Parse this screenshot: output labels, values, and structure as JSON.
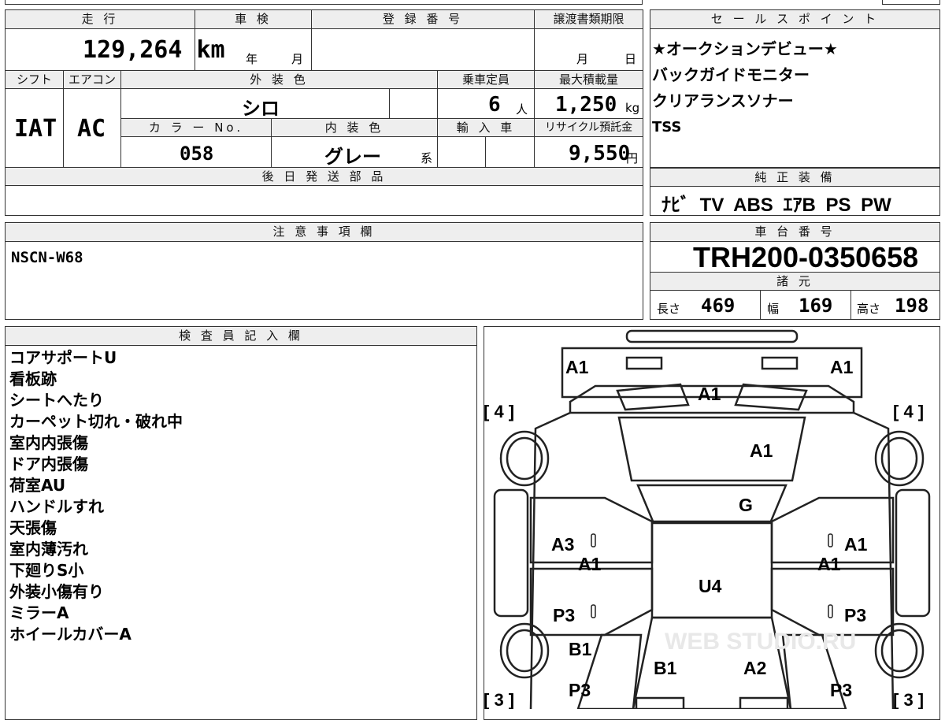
{
  "top": {
    "mileage_label": "走 行",
    "shaken_label": "車 検",
    "registration_label": "登 録 番 号",
    "transfer_deadline_label": "譲渡書類期限",
    "mileage_value": "129,264 km",
    "shaken_year_unit": "年",
    "shaken_month_unit": "月",
    "deadline_month_unit": "月",
    "deadline_day_unit": "日",
    "shift_label": "シフト",
    "aircon_label": "エアコン",
    "exterior_color_label": "外 装 色",
    "capacity_label": "乗車定員",
    "max_load_label": "最大積載量",
    "shift_value": "IAT",
    "aircon_value": "AC",
    "exterior_color_value": "シロ",
    "capacity_value": "6",
    "capacity_unit": "人",
    "max_load_value": "1,250",
    "max_load_unit": "kg",
    "color_no_label": "カ ラ ー No.",
    "interior_color_label": "内 装 色",
    "import_label": "輸 入 車",
    "recycle_label": "リサイクル預託金",
    "color_no_value": "058",
    "interior_color_value": "グレー",
    "interior_color_suffix": "系",
    "recycle_value": "9,550",
    "recycle_unit": "円",
    "later_parts_label": "後 日 発 送 部 品",
    "notes_label": "注 意 事 項 欄",
    "notes_value": "NSCN-W68"
  },
  "sales_points": {
    "label": "セ ー ル ス ポ イ ン ト",
    "lines": [
      "★オークションデビュー★",
      "バックガイドモニター",
      "クリアランスソナー",
      "TSS"
    ]
  },
  "genuine_equipment": {
    "label": "純 正 装 備",
    "items": "ﾅﾋﾞ TV ABS ｴｱB PS PW"
  },
  "chassis": {
    "label": "車 台 番 号",
    "value": "TRH200-0350658"
  },
  "specs": {
    "label": "諸 元",
    "length_label": "長さ",
    "length_value": "469",
    "width_label": "幅",
    "width_value": "169",
    "height_label": "高さ",
    "height_value": "198"
  },
  "inspector": {
    "label": "検 査 員 記 入 欄",
    "notes": [
      "コアサポートU",
      "看板跡",
      "シートへたり",
      "カーペット切れ・破れ中",
      "室内内張傷",
      "ドア内張傷",
      "荷室AU",
      "ハンドルすれ",
      "天張傷",
      "室内薄汚れ",
      "下廻りS小",
      "外装小傷有り",
      "ミラーA",
      "ホイールカバーA"
    ]
  },
  "diagram": {
    "tire_front_left": "[ 4 ]",
    "tire_front_right": "[ 4 ]",
    "tire_rear_left": "[ 3 ]",
    "tire_rear_right": "[ 3 ]",
    "marks": {
      "front_bumper_left": "A1",
      "front_bumper_right": "A1",
      "hood_front": "A1",
      "windshield": "A1",
      "dash": "G",
      "left_front_door": "A3",
      "left_pillar": "A1",
      "right_front_door": "A1",
      "right_pillar": "A1",
      "roof": "U4",
      "left_rear_door": "P3",
      "right_rear_door": "P3",
      "left_rear_panel": "B1",
      "left_rear_bumper": "P3",
      "rear_left": "B1",
      "rear_right": "A2",
      "right_rear_bumper": "P3"
    }
  },
  "watermark": "WEB STUDIO.RU"
}
